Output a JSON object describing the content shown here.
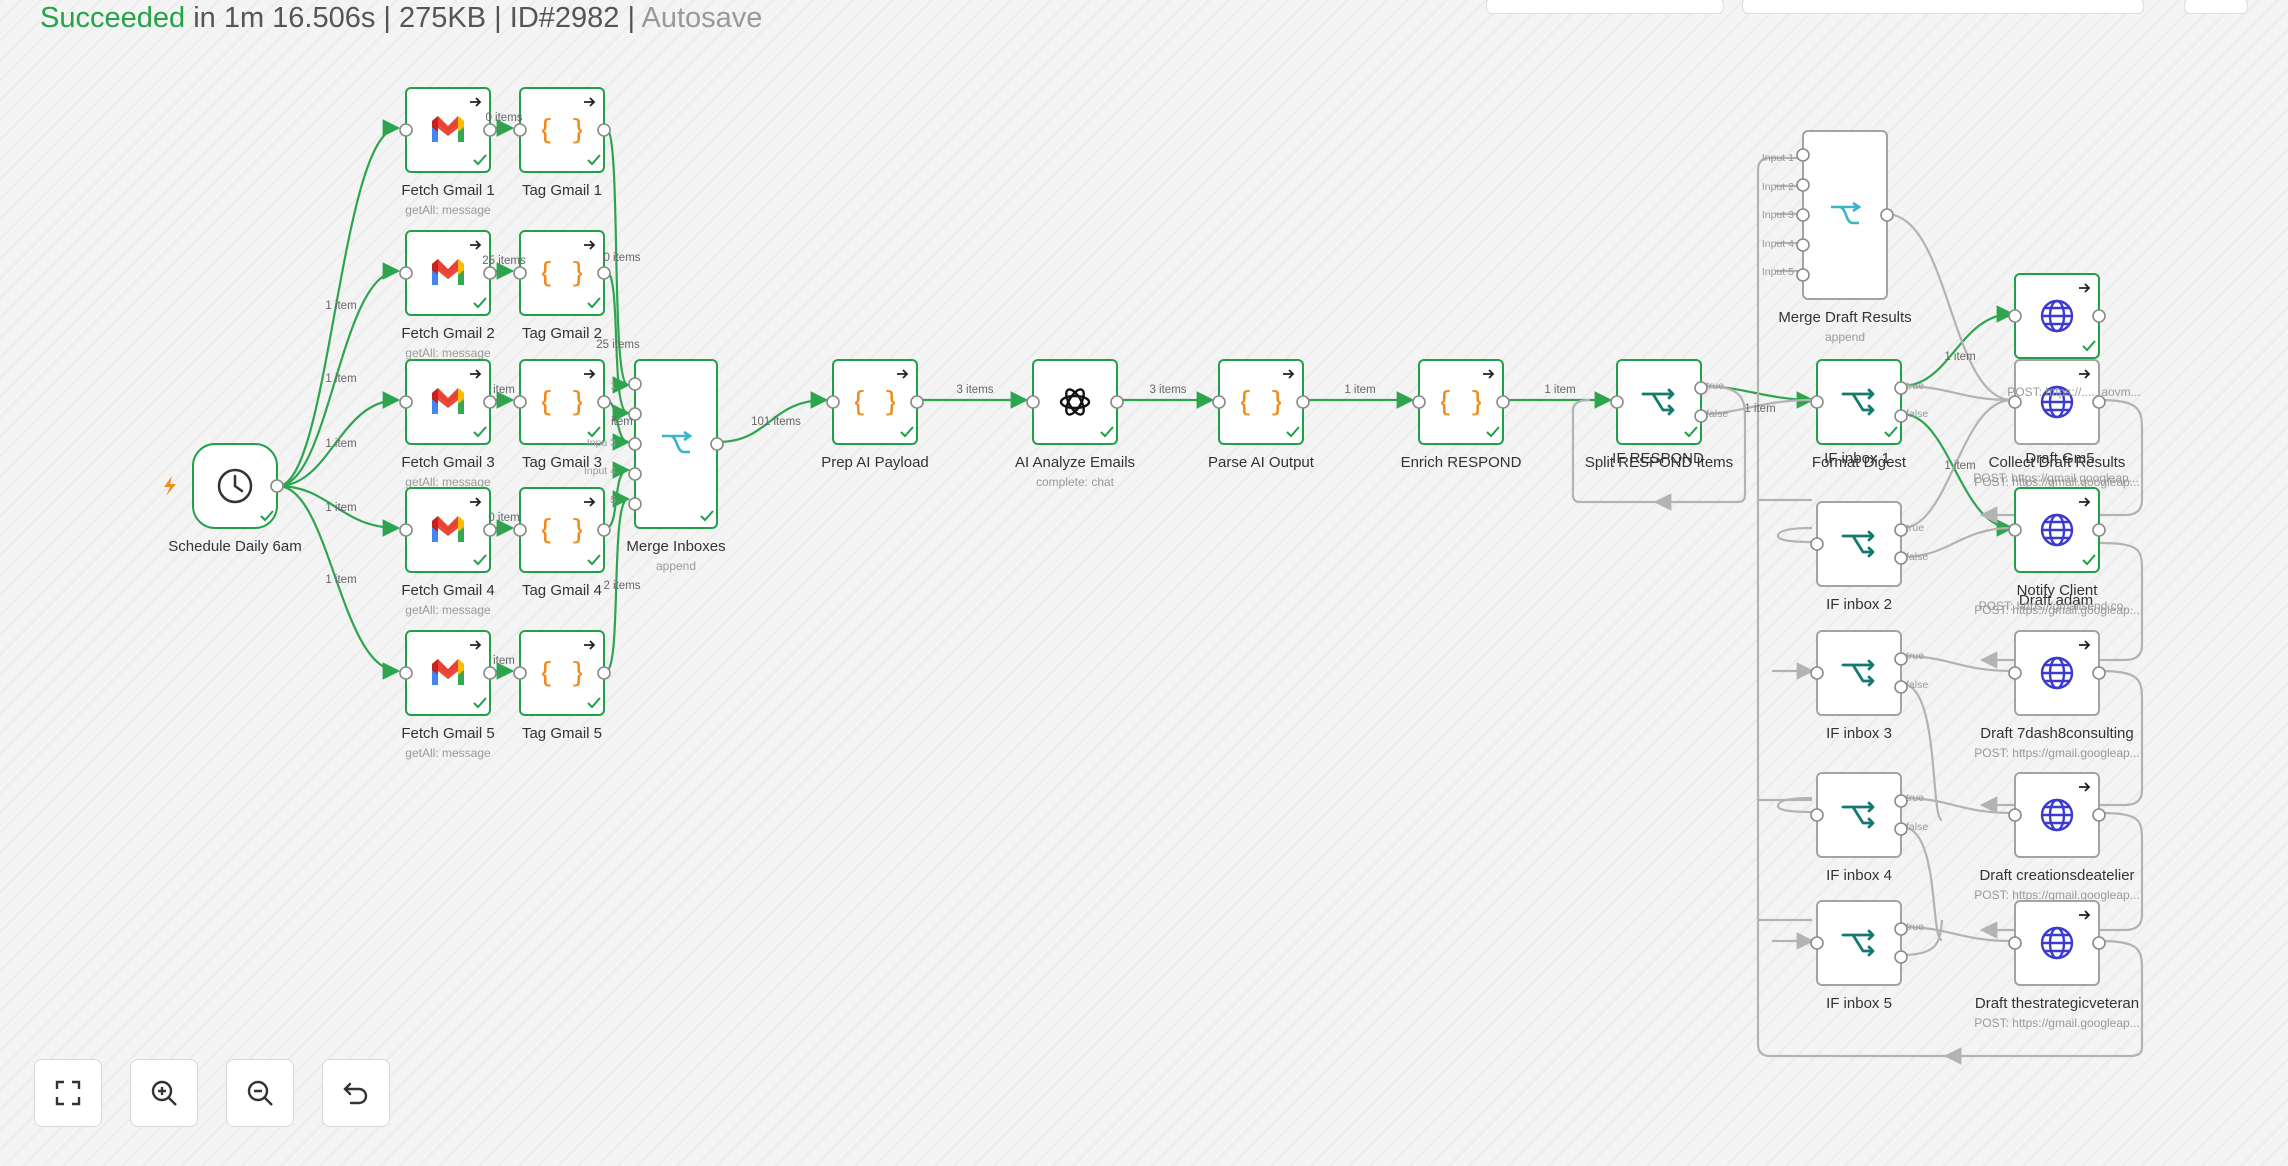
{
  "status": {
    "result": "Succeeded",
    "duration": "in 1m 16.506s",
    "size": "275KB",
    "execution_id": "ID#2982",
    "autosave": "Autosave",
    "separator": "|"
  },
  "nodes": [
    {
      "id": "schedule",
      "label": "Schedule Daily 6am",
      "sub": "",
      "icon": "clock-icon",
      "status": "success"
    },
    {
      "id": "fetch1",
      "label": "Fetch Gmail 1",
      "sub": "getAll: message",
      "icon": "gmail-icon",
      "status": "success"
    },
    {
      "id": "fetch2",
      "label": "Fetch Gmail 2",
      "sub": "getAll: message",
      "icon": "gmail-icon",
      "status": "success"
    },
    {
      "id": "fetch3",
      "label": "Fetch Gmail 3",
      "sub": "getAll: message",
      "icon": "gmail-icon",
      "status": "success"
    },
    {
      "id": "fetch4",
      "label": "Fetch Gmail 4",
      "sub": "getAll: message",
      "icon": "gmail-icon",
      "status": "success"
    },
    {
      "id": "fetch5",
      "label": "Fetch Gmail 5",
      "sub": "getAll: message",
      "icon": "gmail-icon",
      "status": "success"
    },
    {
      "id": "tag1",
      "label": "Tag Gmail 1",
      "sub": "",
      "icon": "code-icon",
      "status": "success"
    },
    {
      "id": "tag2",
      "label": "Tag Gmail 2",
      "sub": "",
      "icon": "code-icon",
      "status": "success"
    },
    {
      "id": "tag3",
      "label": "Tag Gmail 3",
      "sub": "",
      "icon": "code-icon",
      "status": "success"
    },
    {
      "id": "tag4",
      "label": "Tag Gmail 4",
      "sub": "",
      "icon": "code-icon",
      "status": "success"
    },
    {
      "id": "tag5",
      "label": "Tag Gmail 5",
      "sub": "",
      "icon": "code-icon",
      "status": "success"
    },
    {
      "id": "mergeInboxes",
      "label": "Merge Inboxes",
      "sub": "append",
      "icon": "merge-icon",
      "status": "success"
    },
    {
      "id": "prep",
      "label": "Prep AI Payload",
      "sub": "",
      "icon": "code-icon",
      "status": "success"
    },
    {
      "id": "ai",
      "label": "AI Analyze Emails",
      "sub": "complete: chat",
      "icon": "openai-icon",
      "status": "success"
    },
    {
      "id": "parse",
      "label": "Parse AI Output",
      "sub": "",
      "icon": "code-icon",
      "status": "success"
    },
    {
      "id": "enrich",
      "label": "Enrich RESPOND",
      "sub": "",
      "icon": "code-icon",
      "status": "success"
    },
    {
      "id": "ifrespond",
      "label": "Split RESPOND Items",
      "sub": "",
      "icon": "switch-icon",
      "status": "success"
    },
    {
      "id": "format",
      "label": "Format Digest",
      "sub": "",
      "icon": "switch-icon",
      "status": "success"
    },
    {
      "id": "if2",
      "label": "IF inbox 2",
      "sub": "",
      "icon": "switch-icon",
      "status": "idle"
    },
    {
      "id": "if3",
      "label": "IF inbox 3",
      "sub": "",
      "icon": "switch-icon",
      "status": "idle"
    },
    {
      "id": "if4",
      "label": "IF inbox 4",
      "sub": "",
      "icon": "switch-icon",
      "status": "idle"
    },
    {
      "id": "if5",
      "label": "IF inbox 5",
      "sub": "",
      "icon": "switch-icon",
      "status": "idle"
    },
    {
      "id": "mergeDraft",
      "label": "Merge Draft Results",
      "sub": "append",
      "icon": "merge-icon",
      "status": "idle"
    },
    {
      "id": "h1",
      "label": "",
      "sub": "",
      "icon": "globe-icon",
      "status": "success"
    },
    {
      "id": "h2",
      "label": "Collect Draft Results",
      "sub": "POST: https://gmail.googleap...",
      "icon": "globe-icon",
      "status": "idle"
    },
    {
      "id": "h3",
      "label": "Notify Client",
      "sub": "POST: https://gmail.googleap...",
      "icon": "globe-icon",
      "status": "success"
    },
    {
      "id": "h4",
      "label": "Draft 7dash8consulting",
      "sub": "POST: https://gmail.googleap...",
      "icon": "globe-icon",
      "status": "idle"
    },
    {
      "id": "h5",
      "label": "Draft creationsdeatelier",
      "sub": "POST: https://gmail.googleap...",
      "icon": "globe-icon",
      "status": "idle"
    },
    {
      "id": "h6",
      "label": "Draft thestrategicveteran",
      "sub": "POST: https://gmail.googleap...",
      "icon": "globe-icon",
      "status": "idle"
    }
  ],
  "edge_labels": [
    {
      "id": "e_s1",
      "text": "1 item"
    },
    {
      "id": "e_s2",
      "text": "1 item"
    },
    {
      "id": "e_s3",
      "text": "1 item"
    },
    {
      "id": "e_s4",
      "text": "1 item"
    },
    {
      "id": "e_s5",
      "text": "1 item"
    },
    {
      "id": "e_f1",
      "text": "0 items"
    },
    {
      "id": "e_f2",
      "text": "25 items"
    },
    {
      "id": "e_f3",
      "text": "item"
    },
    {
      "id": "e_f4",
      "text": "0 item"
    },
    {
      "id": "e_f5",
      "text": "item"
    },
    {
      "id": "e_t2",
      "text": "0 items"
    },
    {
      "id": "e_t3",
      "text": "25 items"
    },
    {
      "id": "e_t4",
      "text": "item"
    },
    {
      "id": "e_t5",
      "text": "2 items"
    },
    {
      "id": "e_merge",
      "text": "101 items"
    },
    {
      "id": "e_prep",
      "text": "3 items"
    },
    {
      "id": "e_ai",
      "text": "3 items"
    },
    {
      "id": "e_parse",
      "text": "1 item"
    },
    {
      "id": "e_enrich",
      "text": "1 item"
    },
    {
      "id": "e_if",
      "text": "1 item"
    },
    {
      "id": "e_fmt",
      "text": "1 item"
    },
    {
      "id": "e_fmt2",
      "text": "1 item"
    }
  ],
  "port_labels": {
    "true": "true",
    "false": "false",
    "input1": "Input 1",
    "input2": "Input 2",
    "input3": "Input 3",
    "input4": "Input 4",
    "input5": "Input 5",
    "input3_short": "Inpu 3",
    "input4_short": "Input 4",
    "input5_short": "5",
    "input1_short": "1"
  },
  "overlap_labels": {
    "ifrespond_overlap": "IF RESPOND",
    "format_overlap": "IF inbox 1",
    "h1_overlap": "Draft Gm5",
    "h3_overlap": "Draft adam",
    "h2_sub_overlap": "POST: https://gmail.googleap...",
    "h1_sub_overlap": "POST: https://......aovm...",
    "h3_sub_overlap": "POST: https://gmailsend.co..."
  },
  "controls": {
    "fit": "fit-view",
    "zoom_in": "zoom-in",
    "zoom_out": "zoom-out",
    "undo": "undo"
  },
  "colors": {
    "success": "#21a04a",
    "idle": "#a3a3a3",
    "code": "#f08c1a",
    "merge": "#3bb5c6",
    "switch": "#127a6e",
    "globe": "#3a3ad0"
  }
}
